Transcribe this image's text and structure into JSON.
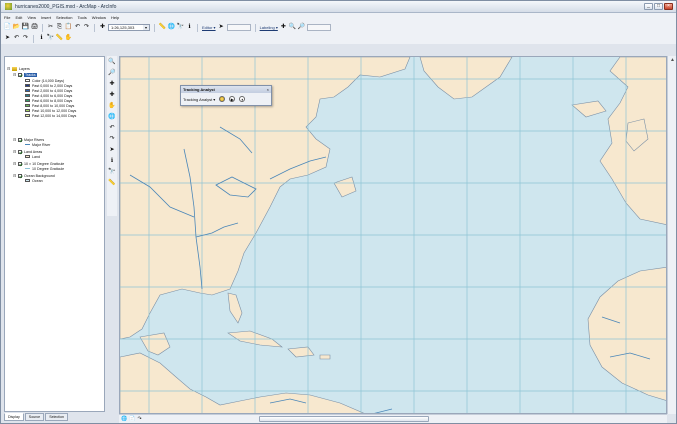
{
  "window": {
    "title": "hurricanes2000_PGIS.mxd - ArcMap - ArcInfo",
    "controls": [
      "_",
      "□",
      "×"
    ]
  },
  "menu": [
    "File",
    "Edit",
    "View",
    "Insert",
    "Selection",
    "Tools",
    "Window",
    "Help"
  ],
  "toolbar": {
    "scale_value": "1:26,125,303",
    "editor_label": "Editor ▾",
    "labeling_label": "Labeling ▾"
  },
  "toc": {
    "root_label": "Layers",
    "layers": [
      {
        "name": "Tracks",
        "selected": true
      },
      {
        "name": "Major Rivers"
      },
      {
        "name": "Land Areas"
      },
      {
        "name": "10 × 10 Degree Graticule"
      },
      {
        "name": "Ocean Background"
      }
    ],
    "legend": [
      {
        "label": "Color (14,000 Days)",
        "color": "#ffffff"
      },
      {
        "label": "Past 0,000 to 2,000 Days",
        "color": "#1f3a8a"
      },
      {
        "label": "Past 2,000 to 4,000 Days",
        "color": "#2f64b0"
      },
      {
        "label": "Past 4,000 to 6,000 Days",
        "color": "#2a7f8e"
      },
      {
        "label": "Past 6,000 to 8,000 Days",
        "color": "#3b9b6a"
      },
      {
        "label": "Past 8,000 to 10,000 Days",
        "color": "#6cb85a"
      },
      {
        "label": "Past 10,000 to 12,000 Days",
        "color": "#a9d36a"
      },
      {
        "label": "Past 12,000 to 14,000 Days",
        "color": "#e6f0b0"
      }
    ],
    "sublabels": {
      "rivers": "Major River",
      "land": "Land",
      "graticule": "10 Degree Graticule",
      "ocean": "Ocean"
    },
    "tabs": [
      "Display",
      "Source",
      "Selection"
    ]
  },
  "tracking_window": {
    "title": "Tracking Analyst",
    "dropdown_label": "Tracking Analyst ▾",
    "close": "×"
  },
  "colors": {
    "ocean": "#cfe6ee",
    "land": "#f7e8cf",
    "graticule": "#8ec3d5",
    "river": "#4a86b8",
    "coast": "#7a8fa5"
  },
  "icons": {
    "new": "📄",
    "open": "📂",
    "save": "💾",
    "print": "🖨",
    "cut": "✂",
    "copy": "⎘",
    "paste": "📋",
    "undo": "↶",
    "redo": "↷",
    "add_data": "✚",
    "zoom_in": "🔍",
    "zoom_out": "🔎",
    "pan": "✋",
    "full_extent": "🌐",
    "identify": "ℹ",
    "find": "🔭",
    "select": "➤",
    "measure": "📏",
    "play": "▶",
    "pause": "⏸",
    "scrollbar_up": "▲",
    "scrollbar_down": "▼"
  }
}
